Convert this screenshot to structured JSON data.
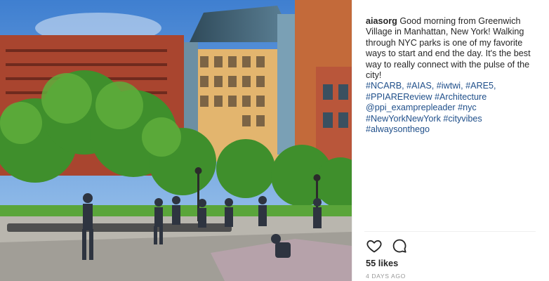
{
  "post": {
    "username": "aiasorg",
    "caption_text": "Good morning from Greenwich Village in Manhattan, New York! Walking through NYC parks is one of my favorite ways to start and end the day. It's the best way to really connect with the pulse of the city!",
    "hashtags": [
      "#NCARB,",
      "#AIAS,",
      "#iwtwi,",
      "#ARE5,",
      "#PPIAREReview",
      "#Architecture",
      "@ppi_examprepleader",
      "#nyc",
      "#NewYorkNewYork",
      "#cityvibes",
      "#alwaysonthego"
    ],
    "likes": "55 likes",
    "timestamp": "4 DAYS AGO"
  },
  "icons": {
    "like": "heart-icon",
    "comment": "comment-icon"
  },
  "colors": {
    "link": "#1f4f8a",
    "text": "#262626",
    "muted": "#999999",
    "border": "#efefef"
  }
}
